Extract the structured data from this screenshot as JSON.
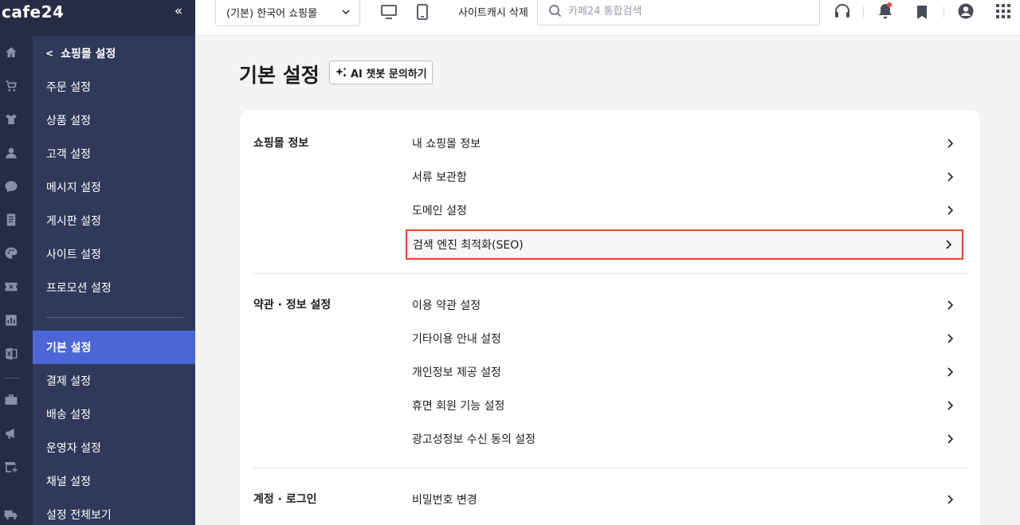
{
  "brand": {
    "logo": "cafe24",
    "collapse_icon": "«"
  },
  "rail_icons": [
    "home-icon",
    "cart-icon",
    "shirt-icon",
    "person-icon",
    "chat-icon",
    "document-icon",
    "palette-icon",
    "ticket-icon",
    "chart-icon",
    "excel-icon",
    "store-icon",
    "megaphone-icon",
    "shop-add-icon",
    "truck-icon"
  ],
  "submenu": {
    "back_label": "쇼핑몰 설정",
    "items_top": [
      "주문 설정",
      "상품 설정",
      "고객 설정",
      "메시지 설정",
      "게시판 설정",
      "사이트 설정",
      "프로모션 설정"
    ],
    "items_bottom": [
      "기본 설정",
      "결제 설정",
      "배송 설정",
      "운영자 설정",
      "채널 설정",
      "설정 전체보기"
    ],
    "active": "기본 설정"
  },
  "topbar": {
    "mall_select": "(기본) 한국어 쇼핑몰",
    "cache_clear": "사이트캐시 삭제",
    "search_placeholder": "카페24 통합검색"
  },
  "page": {
    "title": "기본 설정",
    "ai_button": "AI 챗봇 문의하기"
  },
  "sections": [
    {
      "title": "쇼핑몰 정보",
      "links": [
        "내 쇼핑몰 정보",
        "서류 보관함",
        "도메인 설정",
        "검색 엔진 최적화(SEO)"
      ]
    },
    {
      "title": "약관 · 정보 설정",
      "links": [
        "이용 약관 설정",
        "기타이용 안내 설정",
        "개인정보 제공 설정",
        "휴면 회원 기능 설정",
        "광고성정보 수신 동의 설정"
      ]
    },
    {
      "title": "계정 · 로그인",
      "links": [
        "비밀번호 변경"
      ]
    }
  ],
  "colors": {
    "sidebar": "#31395a",
    "rail": "#262c45",
    "active": "#4c66d8",
    "highlight_border": "#e4472a"
  }
}
